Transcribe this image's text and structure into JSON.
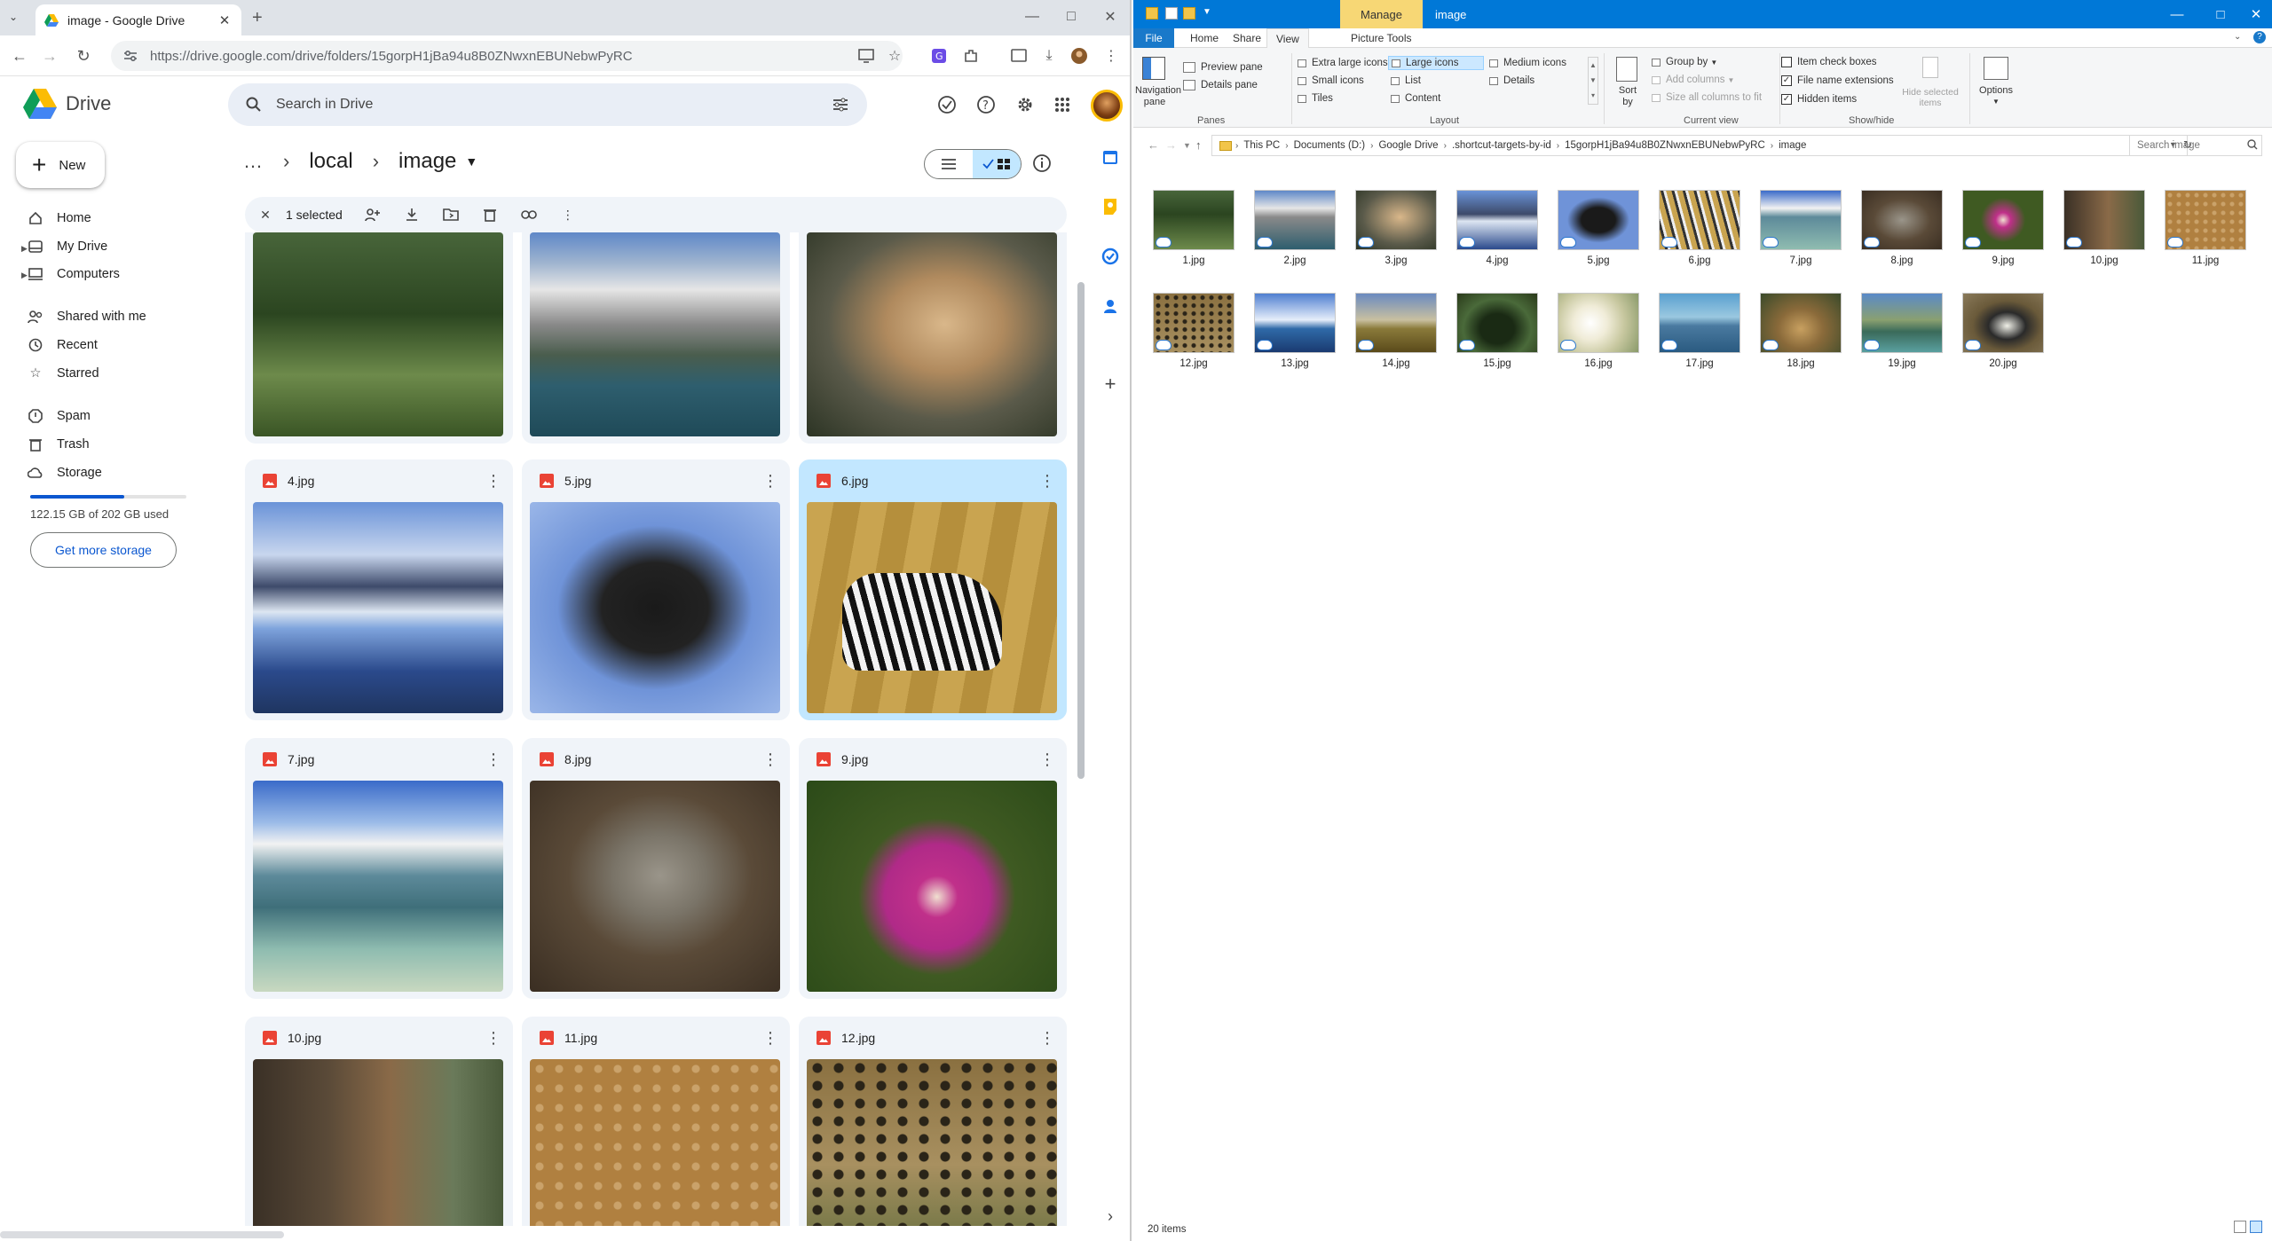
{
  "chrome": {
    "tab_title": "image - Google Drive",
    "url": "https://drive.google.com/drive/folders/15gorpH1jBa94u8B0ZNwxnEBUNebwPyRC",
    "new_tab": "+"
  },
  "drive": {
    "logo_text": "Drive",
    "search_placeholder": "Search in Drive",
    "new_button": "New",
    "sidebar": [
      {
        "label": "Home",
        "icon": "home-icon"
      },
      {
        "label": "My Drive",
        "icon": "my-drive-icon"
      },
      {
        "label": "Computers",
        "icon": "computers-icon"
      },
      {
        "label": "Shared with me",
        "icon": "people-icon"
      },
      {
        "label": "Recent",
        "icon": "clock-icon"
      },
      {
        "label": "Starred",
        "icon": "star-icon"
      },
      {
        "label": "Spam",
        "icon": "spam-icon"
      },
      {
        "label": "Trash",
        "icon": "trash-icon"
      },
      {
        "label": "Storage",
        "icon": "cloud-icon"
      }
    ],
    "storage": {
      "text": "122.15 GB of 202 GB used",
      "used_fraction": 0.605
    },
    "get_more_storage": "Get more storage",
    "breadcrumbs": {
      "more": "…",
      "parent": "local",
      "current": "image"
    },
    "selection": {
      "count_label": "1 selected"
    },
    "files": [
      {
        "name": "1.jpg",
        "selected": false
      },
      {
        "name": "2.jpg",
        "selected": false
      },
      {
        "name": "3.jpg",
        "selected": false
      },
      {
        "name": "4.jpg",
        "selected": false
      },
      {
        "name": "5.jpg",
        "selected": false
      },
      {
        "name": "6.jpg",
        "selected": true
      },
      {
        "name": "7.jpg",
        "selected": false
      },
      {
        "name": "8.jpg",
        "selected": false
      },
      {
        "name": "9.jpg",
        "selected": false
      },
      {
        "name": "10.jpg",
        "selected": false
      },
      {
        "name": "11.jpg",
        "selected": false
      },
      {
        "name": "12.jpg",
        "selected": false
      }
    ]
  },
  "explorer": {
    "title": "image",
    "manage_tab": "Manage",
    "tabs": {
      "file": "File",
      "home": "Home",
      "share": "Share",
      "view": "View",
      "picture_tools": "Picture Tools"
    },
    "ribbon": {
      "panes": {
        "navigation_pane": "Navigation pane",
        "preview_pane": "Preview pane",
        "details_pane": "Details pane",
        "group": "Panes"
      },
      "layout": {
        "extra_large": "Extra large icons",
        "large": "Large icons",
        "medium": "Medium icons",
        "small": "Small icons",
        "list": "List",
        "details": "Details",
        "tiles": "Tiles",
        "content": "Content",
        "group": "Layout",
        "selected": "Large icons"
      },
      "current_view": {
        "sort_by": "Sort by",
        "group_by": "Group by",
        "add_columns": "Add columns",
        "size_columns": "Size all columns to fit",
        "group": "Current view"
      },
      "show_hide": {
        "item_check_boxes": "Item check boxes",
        "file_name_extensions": "File name extensions",
        "hidden_items": "Hidden items",
        "hide_selected": "Hide selected items",
        "group": "Show/hide",
        "checked": {
          "item_check_boxes": false,
          "file_name_extensions": true,
          "hidden_items": true
        }
      },
      "options": "Options"
    },
    "address": [
      "This PC",
      "Documents (D:)",
      "Google Drive",
      ".shortcut-targets-by-id",
      "15gorpH1jBa94u8B0ZNwxnEBUNebwPyRC",
      "image"
    ],
    "search_placeholder": "Search image",
    "files": [
      "1.jpg",
      "2.jpg",
      "3.jpg",
      "4.jpg",
      "5.jpg",
      "6.jpg",
      "7.jpg",
      "8.jpg",
      "9.jpg",
      "10.jpg",
      "11.jpg",
      "12.jpg",
      "13.jpg",
      "14.jpg",
      "15.jpg",
      "16.jpg",
      "17.jpg",
      "18.jpg",
      "19.jpg",
      "20.jpg"
    ],
    "status": "20 items"
  },
  "colors": {
    "drive_selected": "#c2e7ff",
    "drive_card": "#f0f4f9",
    "explorer_titlebar": "#0078d7",
    "manage_tab": "#f7d775",
    "accent_blue": "#0b57d0"
  }
}
